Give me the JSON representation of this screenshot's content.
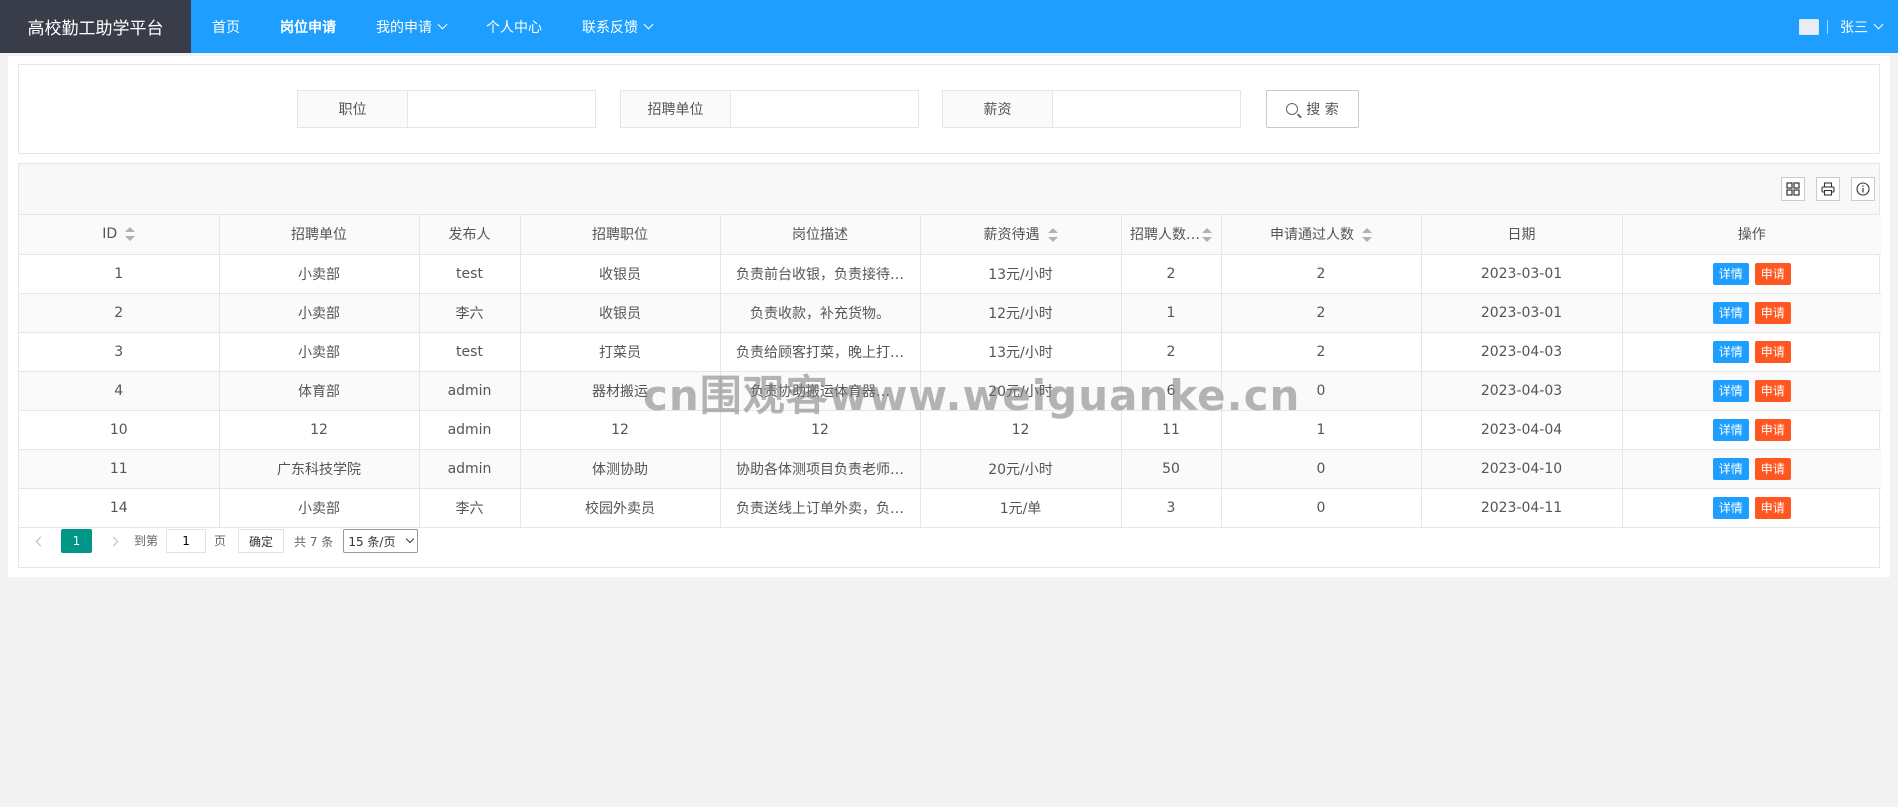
{
  "header": {
    "logo": "高校勤工助学平台",
    "nav": [
      {
        "label": "首页"
      },
      {
        "label": "岗位申请",
        "active": true
      },
      {
        "label": "我的申请",
        "dropdown": true
      },
      {
        "label": "个人中心"
      },
      {
        "label": "联系反馈",
        "dropdown": true
      }
    ],
    "user_name": "张三",
    "brand_color": "#1e9fff"
  },
  "search": {
    "fields": [
      {
        "label": "职位",
        "value": ""
      },
      {
        "label": "招聘单位",
        "value": ""
      },
      {
        "label": "薪资",
        "value": ""
      }
    ],
    "button_label": "搜 索"
  },
  "toolbar": {
    "icons": [
      "columns-icon",
      "print-icon",
      "info-icon"
    ]
  },
  "table": {
    "columns": [
      "ID",
      "招聘单位",
      "发布人",
      "招聘职位",
      "岗位描述",
      "薪资待遇",
      "招聘人数…",
      "申请通过人数",
      "日期",
      "操作"
    ],
    "rows": [
      {
        "id": "1",
        "unit": "小卖部",
        "publisher": "test",
        "position": "收银员",
        "desc": "负责前台收银，负责接待…",
        "salary": "13元/小时",
        "count": "2",
        "passed": "2",
        "date": "2023-03-01"
      },
      {
        "id": "2",
        "unit": "小卖部",
        "publisher": "李六",
        "position": "收银员",
        "desc": "负责收款，补充货物。",
        "salary": "12元/小时",
        "count": "1",
        "passed": "2",
        "date": "2023-03-01"
      },
      {
        "id": "3",
        "unit": "小卖部",
        "publisher": "test",
        "position": "打菜员",
        "desc": "负责给顾客打菜，晚上打…",
        "salary": "13元/小时",
        "count": "2",
        "passed": "2",
        "date": "2023-04-03"
      },
      {
        "id": "4",
        "unit": "体育部",
        "publisher": "admin",
        "position": "器材搬运",
        "desc": "负责协助搬运体育器…",
        "salary": "20元/小时",
        "count": "6",
        "passed": "0",
        "date": "2023-04-03"
      },
      {
        "id": "10",
        "unit": "12",
        "publisher": "admin",
        "position": "12",
        "desc": "12",
        "salary": "12",
        "count": "11",
        "passed": "1",
        "date": "2023-04-04"
      },
      {
        "id": "11",
        "unit": "广东科技学院",
        "publisher": "admin",
        "position": "体测协助",
        "desc": "协助各体测项目负责老师…",
        "salary": "20元/小时",
        "count": "50",
        "passed": "0",
        "date": "2023-04-10"
      },
      {
        "id": "14",
        "unit": "小卖部",
        "publisher": "李六",
        "position": "校园外卖员",
        "desc": "负责送线上订单外卖，负…",
        "salary": "1元/单",
        "count": "3",
        "passed": "0",
        "date": "2023-04-11"
      }
    ],
    "actions": {
      "detail": "详情",
      "apply": "申请"
    }
  },
  "pager": {
    "current_page": "1",
    "goto_label": "到第",
    "goto_value": "1",
    "page_suffix": "页",
    "confirm_label": "确定",
    "total_text": "共 7 条",
    "page_size": "15 条/页"
  },
  "watermark": "cn围观客www.weiguanke.cn"
}
